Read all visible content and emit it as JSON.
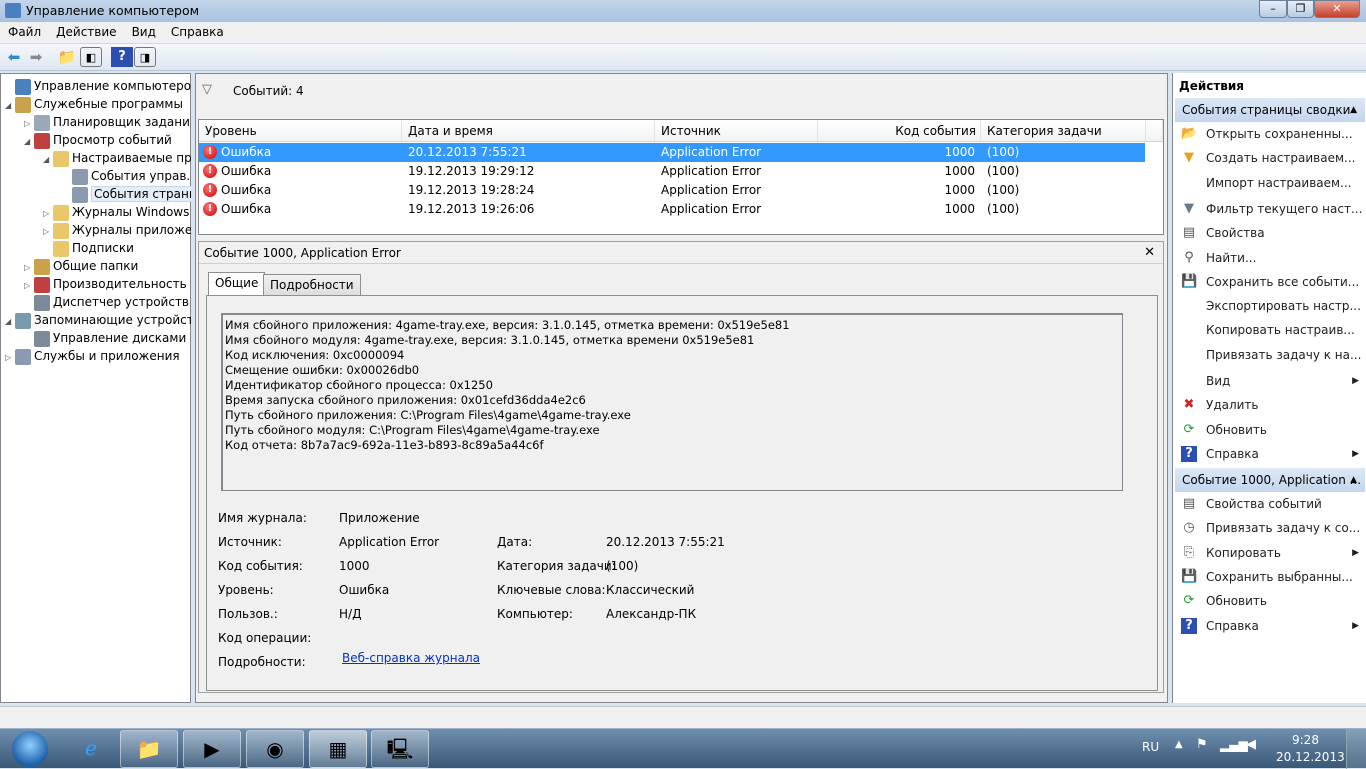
{
  "window": {
    "title": "Управление компьютером"
  },
  "menu": [
    "Файл",
    "Действие",
    "Вид",
    "Справка"
  ],
  "tree": [
    {
      "label": "Управление компьютером (л",
      "level": 0,
      "exp": "",
      "color": "#4a7fc0"
    },
    {
      "label": "Служебные программы",
      "level": 0,
      "exp": "◢",
      "color": "#c9a24a"
    },
    {
      "label": "Планировщик заданий",
      "level": 1,
      "exp": "▷",
      "color": "#9aa8b8"
    },
    {
      "label": "Просмотр событий",
      "level": 1,
      "exp": "◢",
      "color": "#c04040"
    },
    {
      "label": "Настраиваемые пр",
      "level": 2,
      "exp": "◢",
      "color": "#e8c86a"
    },
    {
      "label": "События управ.",
      "level": 3,
      "exp": "",
      "color": "#8a9bb0"
    },
    {
      "label": "События страни",
      "level": 3,
      "exp": "",
      "color": "#8a9bb0",
      "selected": true
    },
    {
      "label": "Журналы Windows",
      "level": 2,
      "exp": "▷",
      "color": "#e8c86a"
    },
    {
      "label": "Журналы приложе",
      "level": 2,
      "exp": "▷",
      "color": "#e8c86a"
    },
    {
      "label": "Подписки",
      "level": 2,
      "exp": "",
      "color": "#e8c86a"
    },
    {
      "label": "Общие папки",
      "level": 1,
      "exp": "▷",
      "color": "#c9a24a"
    },
    {
      "label": "Производительность",
      "level": 1,
      "exp": "▷",
      "color": "#c04040"
    },
    {
      "label": "Диспетчер устройств",
      "level": 1,
      "exp": "",
      "color": "#7a8a9a"
    },
    {
      "label": "Запоминающие устройст",
      "level": 0,
      "exp": "◢",
      "color": "#7a9ab0"
    },
    {
      "label": "Управление дисками",
      "level": 1,
      "exp": "",
      "color": "#7a8a9a"
    },
    {
      "label": "Службы и приложения",
      "level": 0,
      "exp": "▷",
      "color": "#8a9ab0"
    }
  ],
  "events": {
    "count_label": "Событий: 4",
    "columns": [
      "Уровень",
      "Дата и время",
      "Источник",
      "Код события",
      "Категория задачи"
    ],
    "rows": [
      {
        "level": "Ошибка",
        "date": "20.12.2013 7:55:21",
        "source": "Application Error",
        "id": "1000",
        "category": "(100)",
        "selected": true
      },
      {
        "level": "Ошибка",
        "date": "19.12.2013 19:29:12",
        "source": "Application Error",
        "id": "1000",
        "category": "(100)"
      },
      {
        "level": "Ошибка",
        "date": "19.12.2013 19:28:24",
        "source": "Application Error",
        "id": "1000",
        "category": "(100)"
      },
      {
        "level": "Ошибка",
        "date": "19.12.2013 19:26:06",
        "source": "Application Error",
        "id": "1000",
        "category": "(100)"
      }
    ]
  },
  "detail": {
    "title": "Событие 1000, Application Error",
    "tabs": [
      "Общие",
      "Подробности"
    ],
    "description": [
      "Имя сбойного приложения: 4game-tray.exe, версия: 3.1.0.145, отметка времени: 0x519e5e81",
      "Имя сбойного модуля: 4game-tray.exe, версия: 3.1.0.145, отметка времени 0x519e5e81",
      "Код исключения: 0xc0000094",
      "Смещение ошибки: 0x00026db0",
      "Идентификатор сбойного процесса: 0x1250",
      "Время запуска сбойного приложения: 0x01cefd36dda4e2c6",
      "Путь сбойного приложения: C:\\Program Files\\4game\\4game-tray.exe",
      "Путь сбойного модуля: C:\\Program Files\\4game\\4game-tray.exe",
      "Код отчета: 8b7a7ac9-692a-11e3-b893-8c89a5a44c6f"
    ],
    "fields_left": [
      {
        "label": "Имя журнала:",
        "value": "Приложение"
      },
      {
        "label": "Источник:",
        "value": "Application Error"
      },
      {
        "label": "Код события:",
        "value": "1000"
      },
      {
        "label": "Уровень:",
        "value": "Ошибка"
      },
      {
        "label": "Пользов.:",
        "value": "Н/Д"
      },
      {
        "label": "Код операции:",
        "value": ""
      },
      {
        "label": "Подробности:",
        "value": ""
      }
    ],
    "fields_right": [
      {
        "label": "Дата:",
        "value": "20.12.2013 7:55:21"
      },
      {
        "label": "Категория задачи:",
        "value": "(100)"
      },
      {
        "label": "Ключевые слова:",
        "value": "Классический"
      },
      {
        "label": "Компьютер:",
        "value": "Александр-ПК"
      }
    ],
    "link": "Веб-справка журнала"
  },
  "actions": {
    "title": "Действия",
    "section1": "События страницы сводки",
    "items1": [
      {
        "label": "Открыть сохраненны...",
        "icon": "📂"
      },
      {
        "label": "Создать настраиваем...",
        "icon": "▼"
      },
      {
        "label": "Импорт настраиваем...",
        "icon": ""
      },
      {
        "label": "Фильтр текущего наст...",
        "icon": "▼"
      },
      {
        "label": "Свойства",
        "icon": "▤"
      },
      {
        "label": "Найти...",
        "icon": "⚲"
      },
      {
        "label": "Сохранить все событи...",
        "icon": "💾"
      },
      {
        "label": "Экспортировать настр...",
        "icon": ""
      },
      {
        "label": "Копировать настраив...",
        "icon": ""
      },
      {
        "label": "Привязать задачу к на...",
        "icon": ""
      },
      {
        "label": "Вид",
        "icon": "",
        "sub": true
      },
      {
        "label": "Удалить",
        "icon": "✖"
      },
      {
        "label": "Обновить",
        "icon": "⟳"
      },
      {
        "label": "Справка",
        "icon": "?",
        "sub": true
      }
    ],
    "section2": "Событие 1000, Application ...",
    "items2": [
      {
        "label": "Свойства событий",
        "icon": "▤"
      },
      {
        "label": "Привязать задачу к со...",
        "icon": "◷"
      },
      {
        "label": "Копировать",
        "icon": "⎘",
        "sub": true
      },
      {
        "label": "Сохранить выбранны...",
        "icon": "💾"
      },
      {
        "label": "Обновить",
        "icon": "⟳"
      },
      {
        "label": "Справка",
        "icon": "?",
        "sub": true
      }
    ]
  },
  "tray": {
    "lang": "RU",
    "time": "9:28",
    "date": "20.12.2013"
  }
}
